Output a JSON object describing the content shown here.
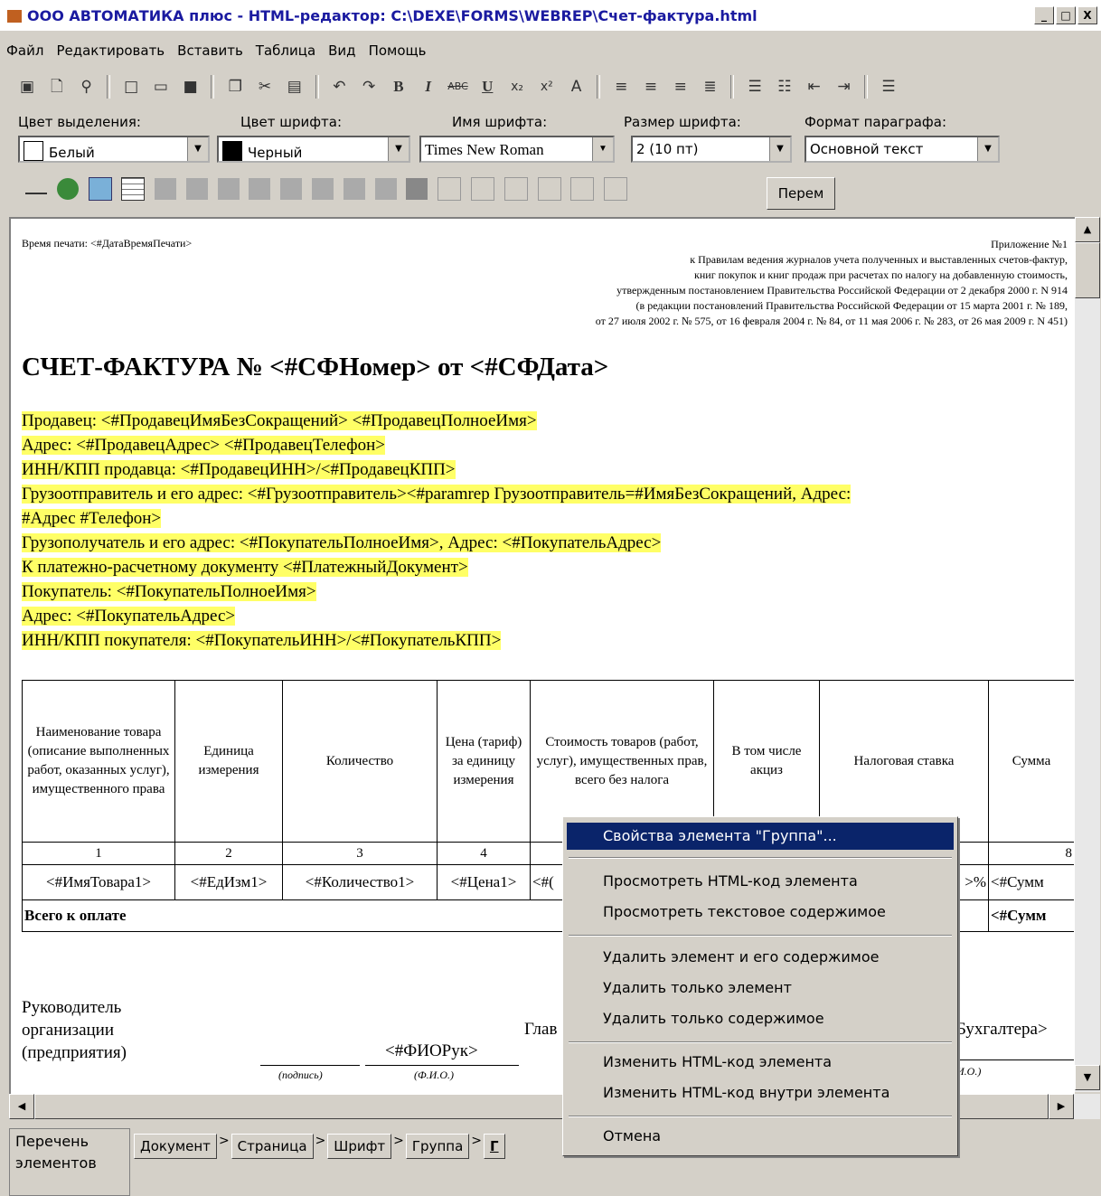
{
  "window": {
    "title": "ООО АВТОМАТИКА плюс - HTML-редактор: C:\\DEXE\\FORMS\\WEBREP\\Счет-фактура.html",
    "minimize": "_",
    "maximize": "□",
    "close": "X"
  },
  "menu": [
    "Файл",
    "Редактировать",
    "Вставить",
    "Таблица",
    "Вид",
    "Помощь"
  ],
  "format": {
    "highlight_label": "Цвет выделения:",
    "highlight_value": "Белый",
    "font_color_label": "Цвет шрифта:",
    "font_color_value": "Черный",
    "font_name_label": "Имя шрифта:",
    "font_name_value": "Times New Roman",
    "font_size_label": "Размер шрифта:",
    "font_size_value": "2 (10 пт)",
    "paragraph_label": "Формат параграфа:",
    "paragraph_value": "Основной текст"
  },
  "toolbar2": {
    "perem_label": "Перем"
  },
  "document": {
    "print_time": "Время печати: <#ДатаВремяПечати>",
    "appendix": [
      "Приложение №1",
      "к Правилам ведения журналов учета полученных и выставленных счетов-фактур,",
      "книг покупок и книг продаж при расчетах по налогу на добавленную стоимость,",
      "утвержденным постановлением Правительства Российской Федерации от 2 декабря 2000 г. N 914",
      "(в редакции постановлений Правительства Российской Федерации от 15 марта 2001 г. № 189,",
      "от 27 июля 2002 г. № 575, от 16 февраля 2004 г. № 84, от 11 мая 2006 г. № 283, от 26 мая 2009 г. N 451)"
    ],
    "title": "СЧЕТ-ФАКТУРА № <#СФНомер> от <#СФДата>",
    "fields": [
      "Продавец: <#ПродавецИмяБезСокращений> <#ПродавецПолноеИмя>",
      "Адрес: <#ПродавецАдрес> <#ПродавецТелефон>",
      "ИНН/КПП продавца: <#ПродавецИНН>/<#ПродавецКПП>",
      "Грузоотправитель и его адрес: <#Грузоотправитель><#paramrep Грузоотправитель=#ИмяБезСокращений, Адрес:",
      "#Адрес #Телефон>",
      "Грузополучатель и его адрес: <#ПокупательПолноеИмя>, Адрес: <#ПокупательАдрес>",
      "К платежно-расчетному документу <#ПлатежныйДокумент>",
      "Покупатель: <#ПокупательПолноеИмя>",
      "Адрес: <#ПокупательАдрес>",
      "ИНН/КПП покупателя: <#ПокупательИНН>/<#ПокупательКПП>"
    ],
    "table": {
      "headers": [
        "Наименование товара (описание выполненных работ, оказанных услуг), имущественного права",
        "Единица измерения",
        "Количество",
        "Цена (тариф) за единицу измерения",
        "Стоимость товаров (работ, услуг), имущественных прав, всего без налога",
        "В том числе акциз",
        "Налоговая ставка",
        "Сумма"
      ],
      "numbers": [
        "1",
        "2",
        "3",
        "4",
        "",
        "",
        "",
        "8"
      ],
      "row": [
        "<#ИмяТовара1>",
        "<#ЕдИзм1>",
        "<#Количество1>",
        "<#Цена1>",
        "<#(",
        "",
        ">%",
        "<#Сумм"
      ],
      "total_label": "Всего к оплате",
      "total_value": "<#Сумм"
    },
    "signature": {
      "head_line1": "Руководитель",
      "head_line2": "организации",
      "head_line3": "(предприятия)",
      "head_fio": "<#ФИОРук>",
      "sign_caption": "(подпись)",
      "fio_caption": "(Ф.И.О.)",
      "chief_prefix": "Глав",
      "chief_suffix": "Бухгалтера>",
      "chief_fio_caption": "И.О.)"
    }
  },
  "context_menu": [
    "Свойства элемента \"Группа\"...",
    "Просмотреть HTML-код элемента",
    "Просмотреть текстовое содержимое",
    "Удалить элемент и его содержимое",
    "Удалить только элемент",
    "Удалить только содержимое",
    "Изменить HTML-код элемента",
    "Изменить HTML-код внутри элемента",
    "Отмена"
  ],
  "bottom": {
    "elements_list": "Перечень элементов",
    "crumbs": [
      "Документ",
      "Страница",
      "Шрифт",
      "Группа",
      "Г"
    ]
  },
  "colors": {
    "highlight": "#ffff66",
    "menu_selection": "#0a246a"
  }
}
